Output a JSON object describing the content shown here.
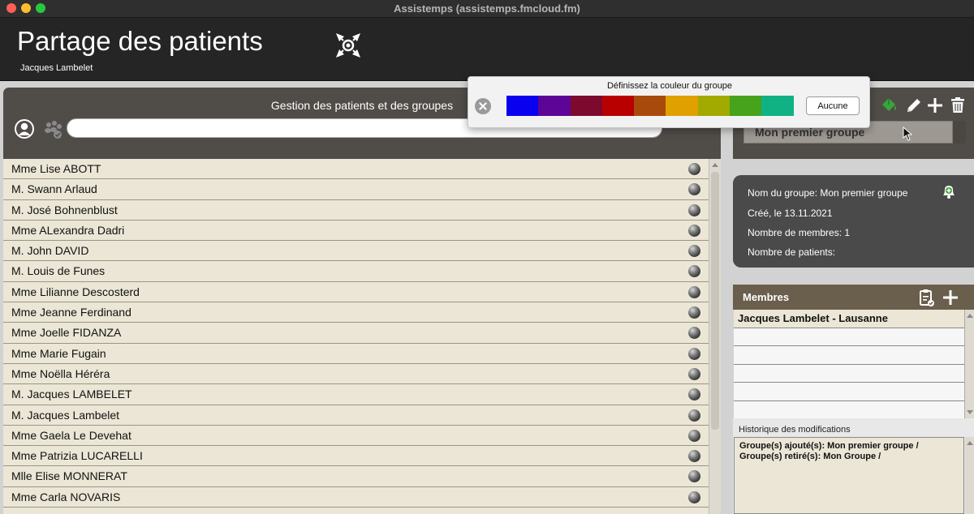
{
  "window": {
    "title": "Assistemps (assistemps.fmcloud.fm)"
  },
  "header": {
    "title": "Partage des patients",
    "user": "Jacques Lambelet"
  },
  "left_panel": {
    "title": "Gestion des patients et des groupes",
    "search": {
      "value": "",
      "placeholder": ""
    },
    "patients": [
      "Mme Lise ABOTT",
      "M. Swann Arlaud",
      "M. José Bohnenblust",
      "Mme ALexandra Dadri",
      "M. John DAVID",
      "M. Louis de Funes",
      "Mme Lilianne Descosterd",
      "Mme Jeanne Ferdinand",
      "Mme Joelle FIDANZA",
      "Mme Marie Fugain",
      "Mme Noëlla Héréra",
      "M. Jacques LAMBELET",
      "M. Jacques Lambelet",
      "Mme Gaela Le Devehat",
      "Mme Patrizia LUCARELLI",
      "Mlle Elise MONNERAT",
      "Mme Carla NOVARIS"
    ]
  },
  "color_popover": {
    "title": "Définissez la couleur du groupe",
    "colors": [
      "#0a00f0",
      "#5c0596",
      "#7d0a2e",
      "#b80000",
      "#a84a0c",
      "#e0a000",
      "#a2aa00",
      "#47a21c",
      "#10b284"
    ],
    "none_label": "Aucune"
  },
  "group": {
    "selected": "Mon premier groupe",
    "info": {
      "name_line": "Nom du groupe: Mon premier groupe",
      "created_line": "Créé, le 13.11.2021",
      "members_count_line": "Nombre de membres: 1",
      "patients_count_line": "Nombre de patients:"
    }
  },
  "members": {
    "title": "Membres",
    "rows": [
      "Jacques Lambelet - Lausanne",
      "",
      "",
      "",
      "",
      ""
    ]
  },
  "history": {
    "label": "Historique des modifications",
    "line1": "Groupe(s) ajouté(s): Mon premier groupe /",
    "line2": "Groupe(s) retiré(s): Mon Groupe /"
  },
  "icons": {
    "collapse": "arrows-inward-icon",
    "person": "person-icon",
    "group_check": "group-check-icon",
    "bucket": "paint-bucket-icon",
    "edit": "pencil-icon",
    "add": "plus-icon",
    "delete": "trash-icon",
    "bell": "bell-add-icon",
    "clipboard": "clipboard-check-icon"
  },
  "colors": {
    "panel_dark": "#504c48",
    "list_bg": "#ebe6d6",
    "bucket_green": "#3aa43a"
  }
}
